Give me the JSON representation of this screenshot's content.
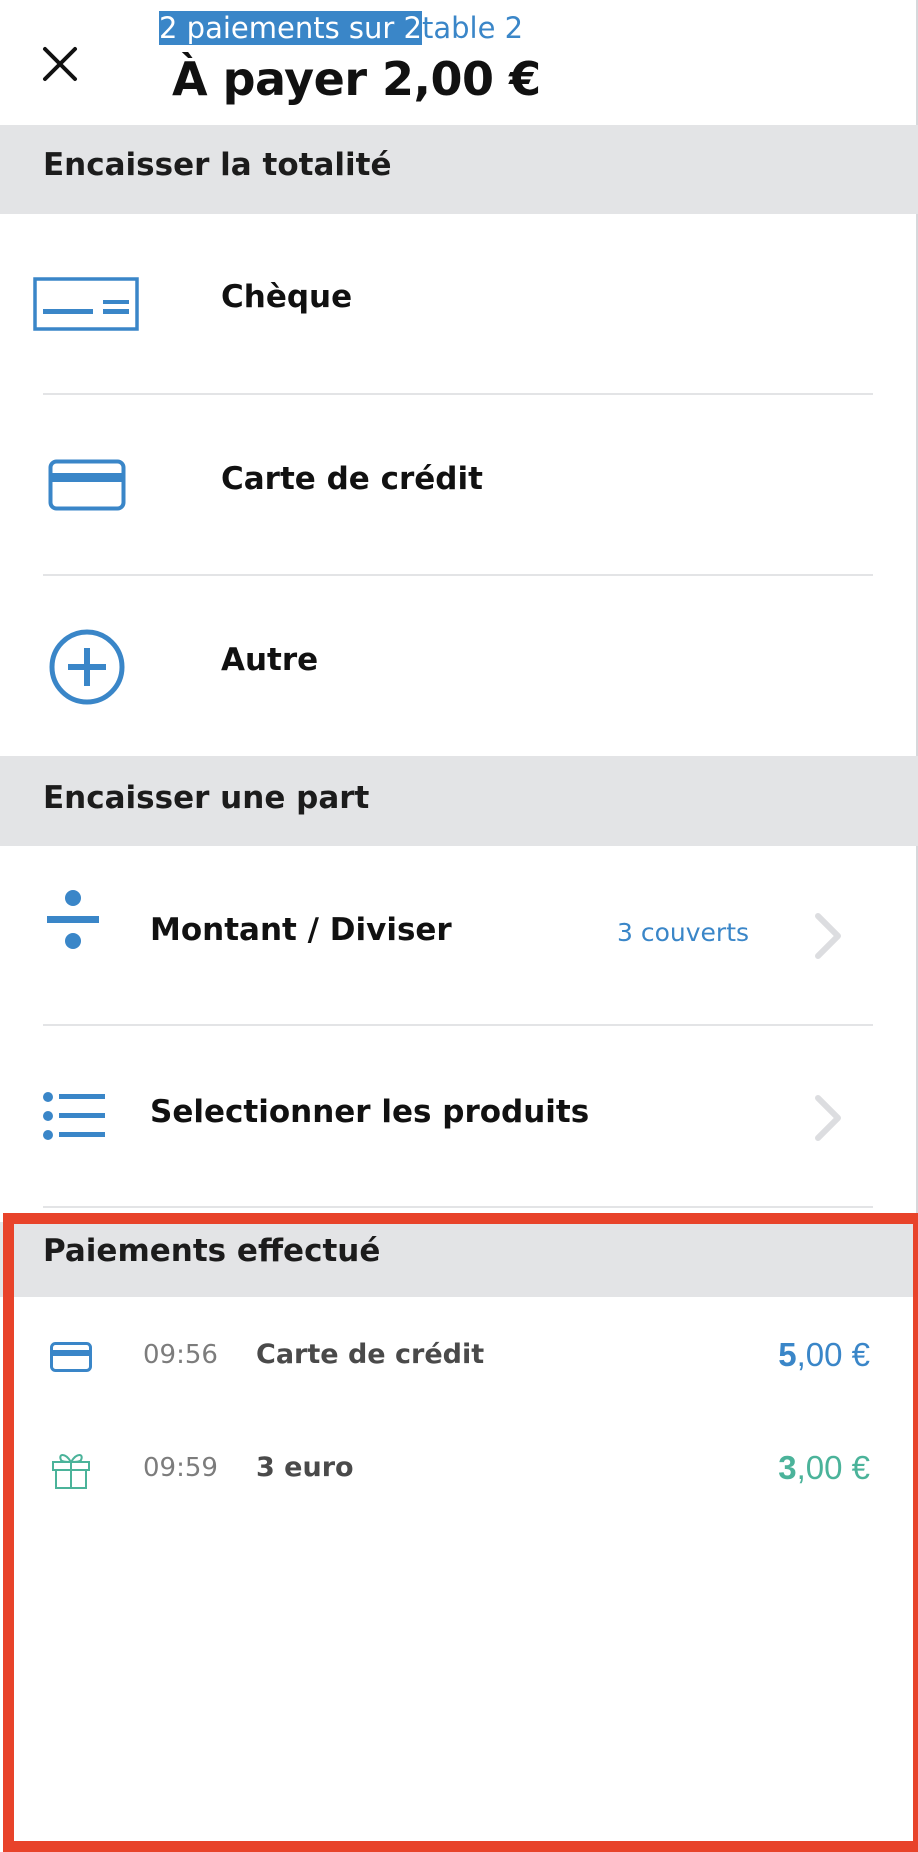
{
  "header": {
    "subtitle_selected": "2 paiements sur 2",
    "subtitle_rest": "table 2",
    "title": "À payer 2,00 €",
    "close_icon": "close-icon"
  },
  "sections": {
    "full": {
      "heading": "Encaisser la totalité",
      "items": [
        {
          "label": "Chèque",
          "icon": "cheque-icon"
        },
        {
          "label": "Carte de crédit",
          "icon": "credit-card-icon"
        },
        {
          "label": "Autre",
          "icon": "plus-circle-icon"
        }
      ]
    },
    "part": {
      "heading": "Encaisser une part",
      "items": [
        {
          "label": "Montant / Diviser",
          "meta": "3 couverts",
          "icon": "divide-icon"
        },
        {
          "label": "Selectionner les produits",
          "meta": "",
          "icon": "list-icon"
        }
      ]
    },
    "done": {
      "heading": "Paiements effectué",
      "payments": [
        {
          "time": "09:56",
          "name": "Carte de crédit",
          "amount_int": "5",
          "amount_dec": ",00 €",
          "color": "#3a86c8",
          "icon": "credit-card-icon"
        },
        {
          "time": "09:59",
          "name": "3 euro",
          "amount_int": "3",
          "amount_dec": ",00 €",
          "color": "#4bb39a",
          "icon": "gift-icon"
        }
      ]
    }
  },
  "colors": {
    "accent": "#3a86c8",
    "green": "#4bb39a",
    "band": "#e3e4e6",
    "highlight": "#e8432a"
  }
}
